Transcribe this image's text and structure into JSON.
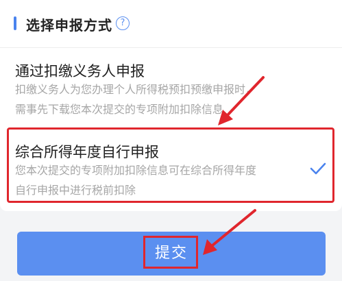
{
  "section": {
    "title": "选择申报方式",
    "help_icon": "question-circle-icon",
    "accent_color": "#4a83ee"
  },
  "options": [
    {
      "title": "通过扣缴义务人申报",
      "desc_lines": [
        "扣缴义务人为您办理个人所得税预扣预缴申报时，",
        "需事先下载您本次提交的专项附加扣除信息"
      ],
      "selected": false
    },
    {
      "title": "综合所得年度自行申报",
      "desc_lines": [
        "您本次提交的专项附加扣除信息可在综合所得年度",
        "自行申报中进行税前扣除"
      ],
      "selected": true
    }
  ],
  "submit": {
    "label": "提交",
    "color": "#5b8ff0"
  },
  "annotation": {
    "color": "#e0262d"
  }
}
